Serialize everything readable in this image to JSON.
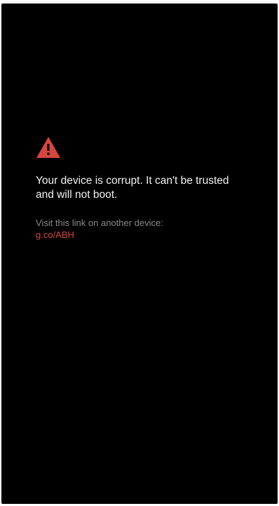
{
  "boot_screen": {
    "icon": "warning-icon",
    "icon_color": "#d6463c",
    "background_color": "#000000",
    "message": "Your device is corrupt. It can't be trusted and will not boot.",
    "visit_prompt": "Visit this link on another device:",
    "link_text": "g.co/ABH",
    "link_color": "#d6463c"
  }
}
